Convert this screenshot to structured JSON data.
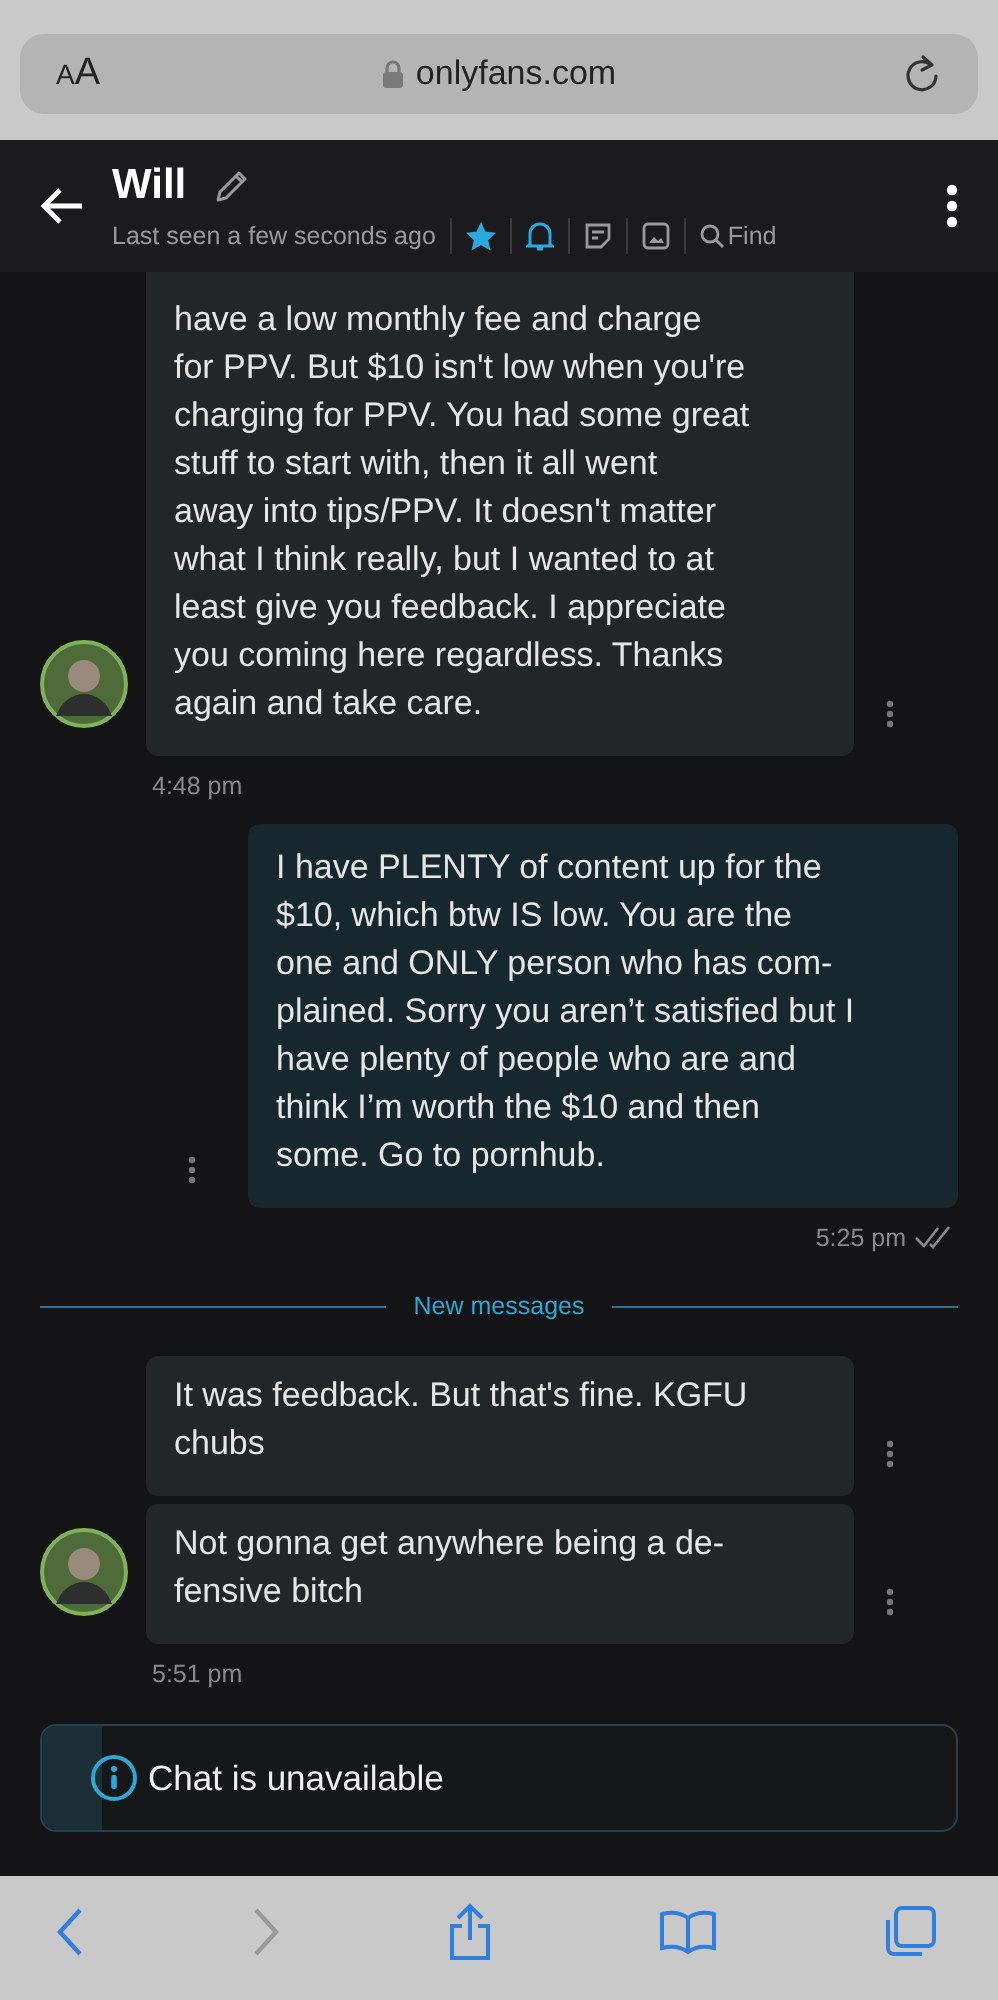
{
  "browser": {
    "text_size_button": "AA",
    "url": "onlyfans.com",
    "back_disabled": false,
    "forward_disabled": true
  },
  "header": {
    "name": "Will",
    "status": "Last seen a few seconds ago",
    "starred": true,
    "notifications_on": true,
    "find_label": "Find"
  },
  "groups": [
    {
      "kind": "incoming",
      "messages": [
        "have a low monthly fee and charge\nfor PPV. But $10 isn't low when you're\ncharging for PPV. You had some great\nstuff to start with, then it all went\naway into tips/PPV. It doesn't matter\nwhat I think really, but I wanted to at\nleast give you feedback. I appreciate\nyou coming here regardless. Thanks\nagain and take care."
      ],
      "time": "4:48 pm"
    },
    {
      "kind": "outgoing",
      "messages": [
        "I have PLENTY of content up for the\n$10, which btw IS low. You are the\none and ONLY person who has com-\nplained. Sorry you aren’t satisfied but I\nhave plenty of people who are and\nthink I’m worth the $10 and then\nsome. Go to pornhub."
      ],
      "time": "5:25 pm",
      "read": true
    },
    {
      "kind": "divider",
      "label": "New messages"
    },
    {
      "kind": "incoming",
      "messages": [
        "It was feedback. But that's fine. KGFU\nchubs",
        "Not gonna get anywhere being a de-\nfensive bitch"
      ],
      "time": "5:51 pm"
    }
  ],
  "notice": "Chat is unavailable"
}
